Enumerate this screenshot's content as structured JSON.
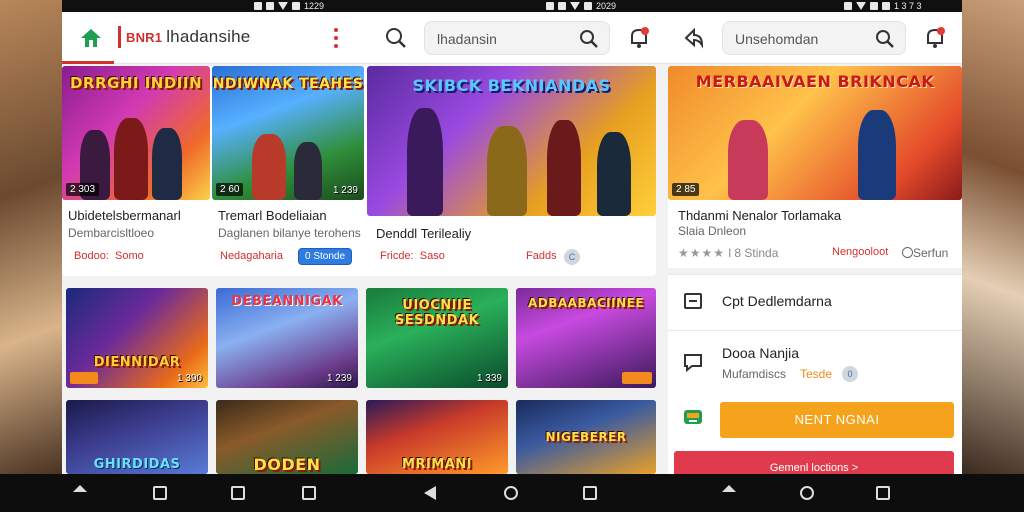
{
  "status_bar": {
    "time_left": "1229",
    "time_mid": "2029",
    "time_right": "1 3 7 3"
  },
  "header": {
    "brand_tag": "BNR1",
    "brand_name": "lhadansihe",
    "search_placeholder_1": "lhadansin",
    "search_placeholder_2": "Unsehomdan"
  },
  "featured": [
    {
      "title_art": "DRRGHI INDIIN",
      "badge": "2 303"
    },
    {
      "title_art": "NDIWNAK TEAHES",
      "badge": "2 60",
      "count": "1 239"
    },
    {
      "title_art": "SKIBCK BEKNIANDAS"
    },
    {
      "title_art": "MERBAAIVAEN BRIKNCAK",
      "badge": "2 85"
    }
  ],
  "cards": [
    {
      "title": "Ubidetelsbermanarl",
      "sub": "Dembarcisltloeo",
      "meta1": "Bodoo:",
      "meta2": "Somo"
    },
    {
      "title": "Tremarl Bodeliaian",
      "sub": "Daglanen bilanye terohens",
      "meta1": "Nedagaharia",
      "pill": "0 Stonde"
    },
    {
      "title": "Denddl Terilealiy",
      "meta1": "Fricde:",
      "meta2": "Saso"
    },
    {
      "title": "Thdanmi Nenalor Torlamaka",
      "sub": "Slaia Dnleon",
      "rating": "★★★★",
      "rating_text": "l 8 Stinda",
      "meta": "Nengooloot",
      "status": "Serfun"
    }
  ],
  "extra_meta": {
    "label": "Fadds",
    "circle": "C"
  },
  "grid_thumbs": [
    {
      "art": "DIENNIDAR",
      "count": "1 390"
    },
    {
      "art": "DEBEANNIGAK",
      "count": "1 239"
    },
    {
      "art": "UIOCNIIE SESDNDAK",
      "count": "1 339"
    },
    {
      "art": "ADBAABACIINEE"
    },
    {
      "art": "GHIRDIDAS"
    },
    {
      "art": "DODEN"
    },
    {
      "art": "MRIMANI"
    },
    {
      "art": "NIGEBERER"
    }
  ],
  "panel": {
    "row1_label": "Cpt Dedlemdarna",
    "row2_title": "Dooa Nanjia",
    "row2_sub": "Mufamdiscs",
    "row2_tag": "Tesde",
    "row2_circle": "0",
    "cta_label": "NENT NGNAI",
    "cta2_label": "Gemenl loctions >"
  }
}
